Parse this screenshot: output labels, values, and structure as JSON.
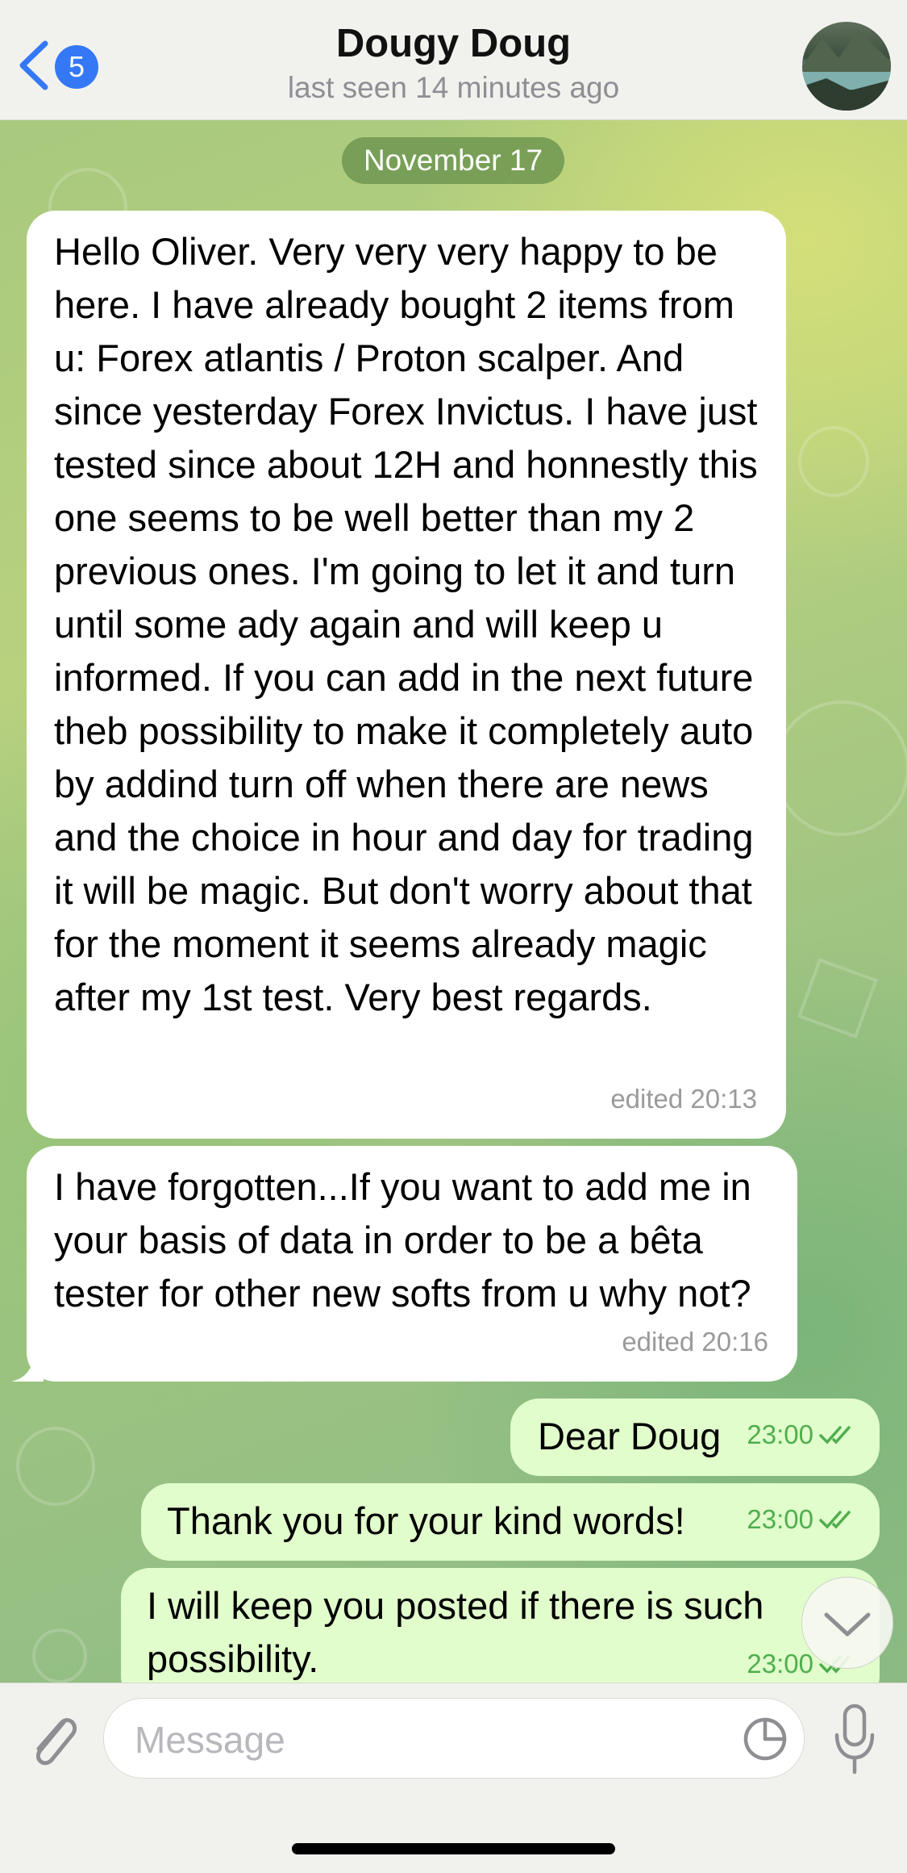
{
  "header": {
    "back_badge": "5",
    "title": "Dougy Doug",
    "status": "last seen 14 minutes ago"
  },
  "chat": {
    "date": "November 17",
    "messages": [
      {
        "direction": "incoming",
        "text": "Hello Oliver. Very very very happy to be here. I have already bought 2 items from u: Forex atlantis / Proton scalper. And since yesterday Forex Invictus. I have just tested since about 12H and honnestly this one seems to be well better than my 2 previous ones. I'm going to let it and turn until some ady again and will keep u informed. If you can add in the next future theb possibility to make it completely auto by addind turn off when there are news and the choice in hour and day for trading it will be magic. But don't worry about that for the moment it seems already magic after my 1st test. Very best regards.",
        "meta": "edited 20:13"
      },
      {
        "direction": "incoming",
        "text": "I have forgotten...If you want to add me in your basis of data in order to be a bêta tester for other new softs from u why not?",
        "meta": "edited 20:16"
      },
      {
        "direction": "outgoing",
        "text": "Dear Doug",
        "meta": "23:00"
      },
      {
        "direction": "outgoing",
        "text": "Thank you for your kind words!",
        "meta": "23:00"
      },
      {
        "direction": "outgoing",
        "text": "I will keep you posted if there is such possibility.",
        "meta": "23:00"
      }
    ]
  },
  "input": {
    "placeholder": "Message"
  },
  "colors": {
    "accent": "#3478f6",
    "outgoing_bubble": "#e1fdcc",
    "incoming_bubble": "#ffffff",
    "read_ticks": "#4fae4e"
  }
}
